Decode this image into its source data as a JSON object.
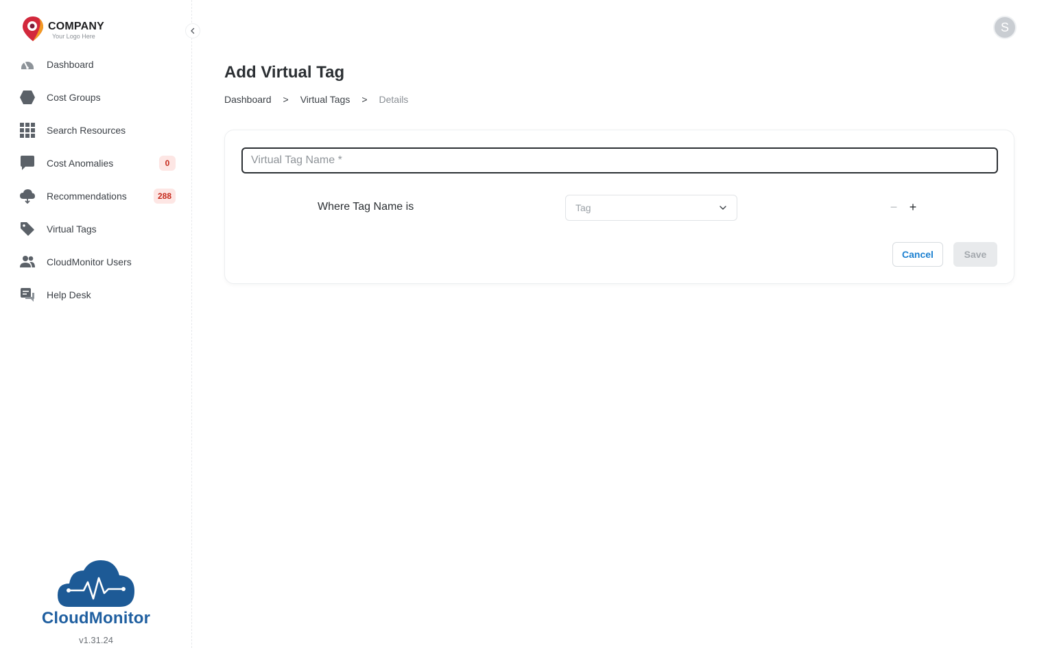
{
  "brand": {
    "company_name": "COMPANY",
    "company_tagline": "Your Logo Here",
    "product_name": "CloudMonitor",
    "version": "v1.31.24",
    "colors": {
      "pin_red": "#d2283c",
      "pin_orange": "#f29a24",
      "cloud_blue": "#1d5a96",
      "badge_bg": "#fde6e4",
      "badge_text": "#c62a1c",
      "link_blue": "#1a7fd0"
    }
  },
  "sidebar": {
    "collapse_icon": "chevron-left-icon",
    "items": [
      {
        "label": "Dashboard",
        "icon": "speedometer-icon",
        "badge": null
      },
      {
        "label": "Cost Groups",
        "icon": "hexagon-icon",
        "badge": null
      },
      {
        "label": "Search Resources",
        "icon": "grid-icon",
        "badge": null
      },
      {
        "label": "Cost Anomalies",
        "icon": "chat-bubble-icon",
        "badge": "0"
      },
      {
        "label": "Recommendations",
        "icon": "cloud-icon",
        "badge": "288"
      },
      {
        "label": "Virtual Tags",
        "icon": "tag-icon",
        "badge": null
      },
      {
        "label": "CloudMonitor Users",
        "icon": "users-icon",
        "badge": null
      },
      {
        "label": "Help Desk",
        "icon": "helpdesk-icon",
        "badge": null
      }
    ]
  },
  "header": {
    "avatar_initial": "S"
  },
  "main": {
    "title": "Add Virtual Tag",
    "breadcrumb": [
      {
        "label": "Dashboard"
      },
      {
        "label": "Virtual Tags"
      },
      {
        "label": "Details"
      }
    ],
    "breadcrumb_separator": ">",
    "form": {
      "name_placeholder": "Virtual Tag Name *",
      "name_value": "",
      "rule_label": "Where Tag Name is",
      "tag_select_placeholder": "Tag",
      "remove_rule_symbol": "−",
      "add_rule_symbol": "+",
      "cancel_label": "Cancel",
      "save_label": "Save"
    }
  }
}
